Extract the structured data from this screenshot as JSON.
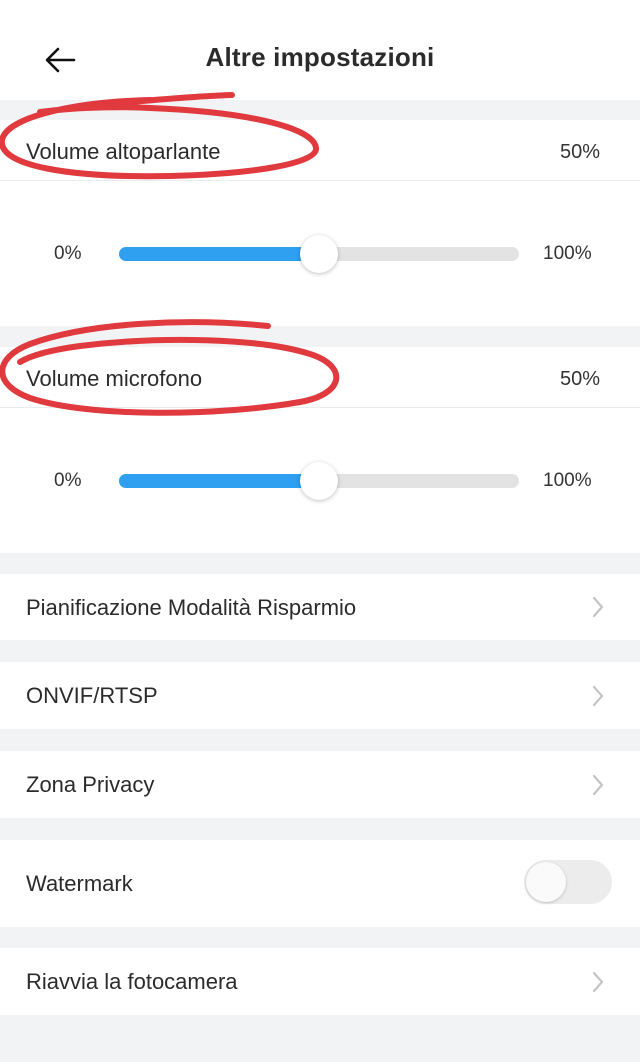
{
  "header": {
    "title": "Altre impostazioni",
    "back_icon": "arrow-left-icon"
  },
  "speaker_volume": {
    "label": "Volume altoparlante",
    "value_text": "50%",
    "value": 50,
    "min_label": "0%",
    "max_label": "100%"
  },
  "mic_volume": {
    "label": "Volume microfono",
    "value_text": "50%",
    "value": 50,
    "min_label": "0%",
    "max_label": "100%"
  },
  "menu": {
    "power_saving": "Pianificazione Modalità Risparmio",
    "onvif": "ONVIF/RTSP",
    "privacy_zone": "Zona Privacy",
    "watermark": "Watermark",
    "watermark_enabled": false,
    "restart": "Riavvia la fotocamera"
  },
  "colors": {
    "accent": "#2f9ff0",
    "annotation": "#e0393e"
  }
}
